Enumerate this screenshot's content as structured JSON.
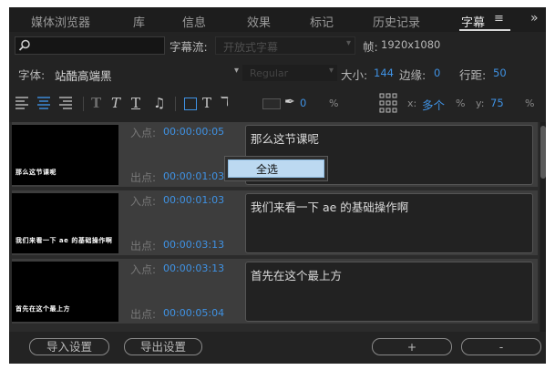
{
  "tabs": [
    {
      "label": "媒体浏览器"
    },
    {
      "label": "库"
    },
    {
      "label": "信息"
    },
    {
      "label": "效果"
    },
    {
      "label": "标记"
    },
    {
      "label": "历史记录"
    },
    {
      "label": "字幕",
      "active": true
    }
  ],
  "tab_menu_glyph": "≡",
  "tab_overflow_glyph": "»",
  "search": {
    "value": "",
    "placeholder": ""
  },
  "subtitle_flow": {
    "label": "字幕流:",
    "value": "开放式字幕"
  },
  "frame": {
    "label": "帧:",
    "value": "1920x1080"
  },
  "font": {
    "label": "字体:",
    "family": "站酷高端黑",
    "style": "Regular",
    "size_label": "大小:",
    "size": "144",
    "stroke_label": "边缘:",
    "stroke": "0",
    "line_spacing_label": "行距:",
    "line_spacing": "50"
  },
  "toolbar": {
    "stroke_value": "0",
    "stroke_unit": "%",
    "x_label": "x:",
    "x_value": "多个",
    "x_unit": "%",
    "y_label": "y:",
    "y_value": "75",
    "y_unit": "%"
  },
  "rows": [
    {
      "in_label": "入点:",
      "in": "00:00:00:05",
      "out_label": "出点:",
      "out": "00:00:01:03",
      "text": "那么这节课呢",
      "thumb": "那么这节课呢"
    },
    {
      "in_label": "入点:",
      "in": "00:00:01:03",
      "out_label": "出点:",
      "out": "00:00:03:13",
      "text": "我们来看一下 ae 的基础操作啊",
      "thumb": "我们来看一下 ae 的基础操作啊"
    },
    {
      "in_label": "入点:",
      "in": "00:00:03:13",
      "out_label": "出点:",
      "out": "00:00:05:04",
      "text": "首先在这个最上方",
      "thumb": "首先在这个最上方"
    }
  ],
  "context_menu": {
    "item": "全选"
  },
  "bottom": {
    "import_label": "导入设置",
    "export_label": "导出设置",
    "add_label": "+",
    "remove_label": "-"
  },
  "colors": {
    "accent": "#3f92e4",
    "panel_bg": "#232323",
    "row_bg": "#3d3d3d",
    "menu_highlight": "#bcd9f1"
  }
}
